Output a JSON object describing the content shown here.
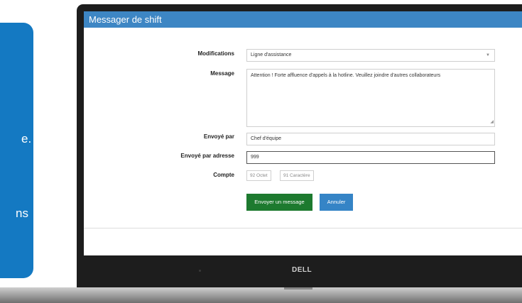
{
  "window": {
    "title": "Messager de shift"
  },
  "form": {
    "modifications_label": "Modifications",
    "modifications_value": "Ligne d'assistance",
    "message_label": "Message",
    "message_value": "Attention ! Forte affluence d'appels à la hotline. Veuillez joindre d'autres collaborateurs",
    "sender_label": "Envoyé par",
    "sender_value": "Chef d'équipe",
    "address_label": "Envoyé par adresse",
    "address_value": "999",
    "count_label": "Compte",
    "octet_count": "92 Octet",
    "char_count": "91 Caractère"
  },
  "buttons": {
    "send": "Envoyer un message",
    "cancel": "Annuler"
  },
  "callout": {
    "fragment1": "e.",
    "fragment2": "ns"
  },
  "device": {
    "brand": "DELL"
  },
  "colors": {
    "titlebar": "#3d86c4",
    "send": "#1d7a2f",
    "cancel": "#3584c6",
    "callout": "#1479c2"
  }
}
